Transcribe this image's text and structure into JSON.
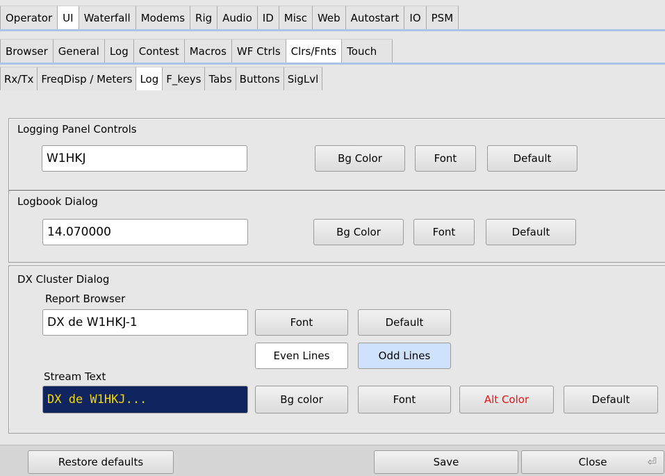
{
  "tabs_row1": [
    "Operator",
    "UI",
    "Waterfall",
    "Modems",
    "Rig",
    "Audio",
    "ID",
    "Misc",
    "Web",
    "Autostart",
    "IO",
    "PSM"
  ],
  "tabs_row2": [
    "Browser",
    "General",
    "Log",
    "Contest",
    "Macros",
    "WF Ctrls",
    "Clrs/Fnts",
    "Touch"
  ],
  "tabs_row3": [
    "Rx/Tx",
    "FreqDisp / Meters",
    "Log",
    "F_keys",
    "Tabs",
    "Buttons",
    "SigLvl"
  ],
  "logging_panel": {
    "label": "Logging Panel Controls",
    "value": "W1HKJ",
    "bg_color_label": "Bg Color",
    "font_label": "Font",
    "default_label": "Default"
  },
  "logbook_dialog": {
    "label": "Logbook Dialog",
    "value": "14.070000",
    "bg_color_label": "Bg Color",
    "font_label": "Font",
    "default_label": "Default"
  },
  "dx_cluster": {
    "label": "DX Cluster Dialog",
    "report_browser_label": "Report Browser",
    "report_value": "DX de W1HKJ-1",
    "font_label": "Font",
    "default_label": "Default",
    "even_lines_label": "Even Lines",
    "odd_lines_label": "Odd Lines",
    "stream_text_label": "Stream Text",
    "stream_value": "DX de W1HKJ...",
    "bg_color_label": "Bg color",
    "stream_font_label": "Font",
    "alt_color_label": "Alt Color",
    "stream_default_label": "Default"
  },
  "footer": {
    "restore_label": "Restore defaults",
    "save_label": "Save",
    "close_label": "Close"
  },
  "colors": {
    "stream_bg": "#10245f",
    "stream_fg": "#f5d800",
    "alt_color": "#ee1010",
    "odd_lines_bg": "#cfe2fb"
  }
}
